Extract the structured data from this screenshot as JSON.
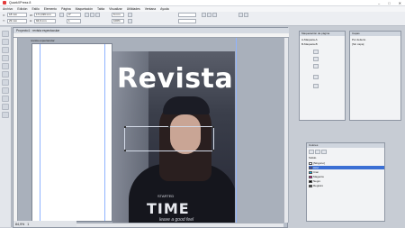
{
  "app": {
    "title": "QuarkXPress 8"
  },
  "menu": [
    "Archivo",
    "Edición",
    "Estilo",
    "Elemento",
    "Página",
    "Maquetación",
    "Tabla",
    "Visualizar",
    "Utilidades",
    "Ventana",
    "Ayuda"
  ],
  "measurements": {
    "x": "18 mm",
    "y": "29 mm",
    "w": "171,199 mm",
    "h": "94,9 mm",
    "angle": "0°",
    "cols": "1",
    "gutter": "6 mm",
    "zoom": "100%"
  },
  "document": {
    "tab_title": "Proyecto1 : revista espectacular",
    "layout_tab": "revista espectacular",
    "masthead": "Revista",
    "print_sub": "STARTED",
    "print_main": "TIME",
    "print_bottom": "leave a good feel",
    "status_zoom": "84,9%",
    "status_page": "1"
  },
  "panels": {
    "page_layout": {
      "title": "Maquetación de página",
      "items": [
        "A-Maqueta-A",
        "B-Maqueta-B"
      ]
    },
    "layers": {
      "title": "Capas",
      "rows": [
        "Por defecto",
        "[Sin capa]"
      ]
    },
    "colors": {
      "title": "Colores",
      "tabs": "Sólido",
      "rows": [
        {
          "label": "[Ninguno]",
          "color": "#ffffff"
        },
        {
          "label": "Azul",
          "color": "#1e3cff"
        },
        {
          "label": "Cian",
          "color": "#00b4e6"
        },
        {
          "label": "Magenta",
          "color": "#e6008c"
        },
        {
          "label": "Negro",
          "color": "#000000"
        },
        {
          "label": "Registro",
          "color": "#444444"
        }
      ]
    }
  }
}
